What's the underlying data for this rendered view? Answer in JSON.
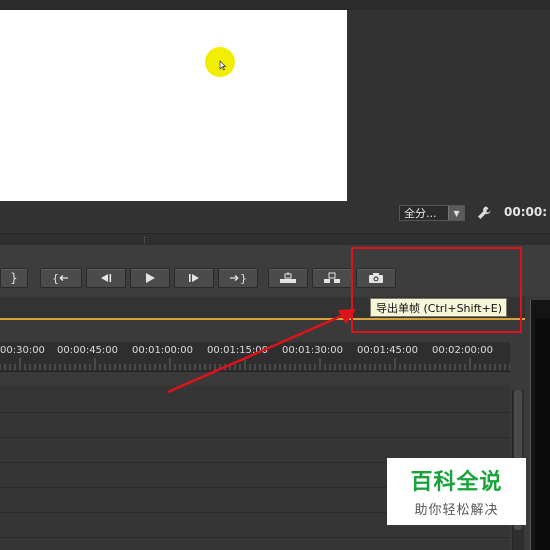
{
  "monitor": {
    "zoom_label": "全分...",
    "timecode": "00:00:"
  },
  "transport": {
    "buttons": [
      {
        "name": "mark-out-button",
        "glyph": "}"
      },
      {
        "name": "go-to-in-button",
        "glyph": "{←"
      },
      {
        "name": "step-back-button",
        "glyph": "◀|"
      },
      {
        "name": "play-button",
        "glyph": "▶"
      },
      {
        "name": "step-forward-button",
        "glyph": "|▶"
      },
      {
        "name": "go-to-out-button",
        "glyph": "→}"
      },
      {
        "name": "lift-button",
        "glyph": "lift"
      },
      {
        "name": "extract-button",
        "glyph": "extract"
      },
      {
        "name": "export-frame-button",
        "glyph": "camera"
      }
    ]
  },
  "tooltip": {
    "text": "导出单帧 (Ctrl+Shift+E)"
  },
  "timeline": {
    "ruler_labels": [
      "00:30:00",
      "00:00:45:00",
      "00:01:00:00",
      "00:01:15:00",
      "00:01:30:00",
      "00:01:45:00",
      "00:02:00:00"
    ]
  },
  "watermark": {
    "title": "百科全说",
    "subtitle": "助你轻松解决"
  },
  "colors": {
    "annotation_red": "#e0111a",
    "cursor_yellow": "#f2ee00",
    "watermark_green": "#1aa33c",
    "timeline_accent": "#d9a33a"
  }
}
